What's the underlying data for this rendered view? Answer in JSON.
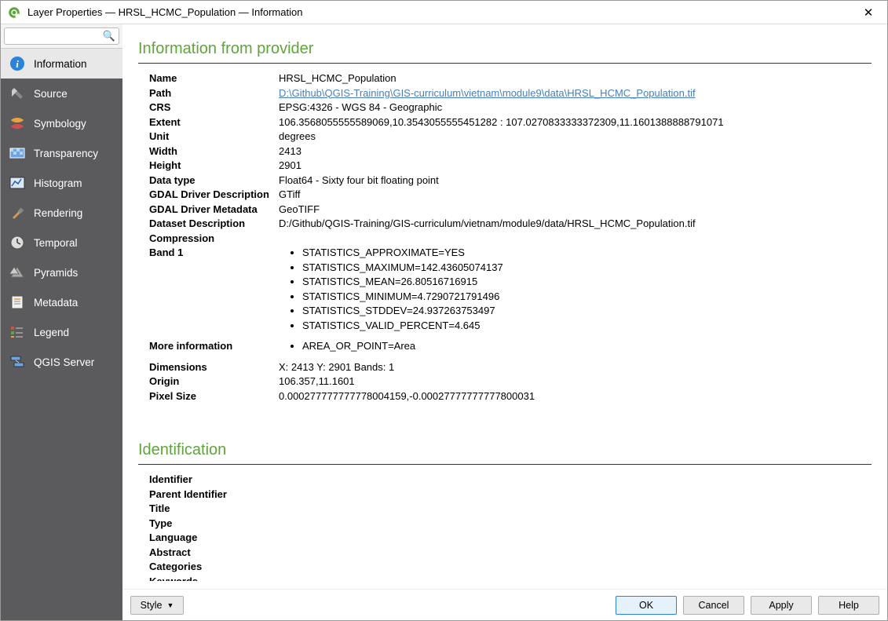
{
  "window": {
    "title": "Layer Properties — HRSL_HCMC_Population — Information"
  },
  "search": {
    "placeholder": ""
  },
  "sidebar": {
    "items": [
      {
        "label": "Information",
        "icon": "info-icon",
        "selected": true
      },
      {
        "label": "Source",
        "icon": "source-icon"
      },
      {
        "label": "Symbology",
        "icon": "symbology-icon"
      },
      {
        "label": "Transparency",
        "icon": "transparency-icon"
      },
      {
        "label": "Histogram",
        "icon": "histogram-icon"
      },
      {
        "label": "Rendering",
        "icon": "rendering-icon"
      },
      {
        "label": "Temporal",
        "icon": "temporal-icon"
      },
      {
        "label": "Pyramids",
        "icon": "pyramids-icon"
      },
      {
        "label": "Metadata",
        "icon": "metadata-icon"
      },
      {
        "label": "Legend",
        "icon": "legend-icon"
      },
      {
        "label": "QGIS Server",
        "icon": "server-icon"
      }
    ]
  },
  "sections": {
    "provider_title": "Information from provider",
    "identification_title": "Identification"
  },
  "provider": {
    "name_k": "Name",
    "name_v": "HRSL_HCMC_Population",
    "path_k": "Path",
    "path_v": "D:\\Github\\QGIS-Training\\GIS-curriculum\\vietnam\\module9\\data\\HRSL_HCMC_Population.tif",
    "crs_k": "CRS",
    "crs_v": "EPSG:4326 - WGS 84 - Geographic",
    "extent_k": "Extent",
    "extent_v": "106.3568055555589069,10.3543055555451282 : 107.0270833333372309,11.1601388888791071",
    "unit_k": "Unit",
    "unit_v": "degrees",
    "width_k": "Width",
    "width_v": "2413",
    "height_k": "Height",
    "height_v": "2901",
    "dtype_k": "Data type",
    "dtype_v": "Float64 - Sixty four bit floating point",
    "gdaldesc_k": "GDAL Driver Description",
    "gdaldesc_v": "GTiff",
    "gdalmeta_k": "GDAL Driver Metadata",
    "gdalmeta_v": "GeoTIFF",
    "dsdesc_k": "Dataset Description",
    "dsdesc_v": "D:/Github/QGIS-Training/GIS-curriculum/vietnam/module9/data/HRSL_HCMC_Population.tif",
    "compression_k": "Compression",
    "compression_v": "",
    "band1_k": "Band 1",
    "band1_items": [
      "STATISTICS_APPROXIMATE=YES",
      "STATISTICS_MAXIMUM=142.43605074137",
      "STATISTICS_MEAN=26.80516716915",
      "STATISTICS_MINIMUM=4.7290721791496",
      "STATISTICS_STDDEV=24.937263753497",
      "STATISTICS_VALID_PERCENT=4.645"
    ],
    "moreinfo_k": "More information",
    "moreinfo_items": [
      "AREA_OR_POINT=Area"
    ],
    "dimensions_k": "Dimensions",
    "dimensions_v": "X: 2413 Y: 2901 Bands: 1",
    "origin_k": "Origin",
    "origin_v": "106.357,11.1601",
    "pixelsize_k": "Pixel Size",
    "pixelsize_v": "0.000277777777778004159,-0.00027777777777800031"
  },
  "identification": {
    "identifier_k": "Identifier",
    "parentid_k": "Parent Identifier",
    "title_k": "Title",
    "type_k": "Type",
    "language_k": "Language",
    "abstract_k": "Abstract",
    "categories_k": "Categories",
    "keywords_k": "Keywords"
  },
  "buttons": {
    "style": "Style",
    "ok": "OK",
    "cancel": "Cancel",
    "apply": "Apply",
    "help": "Help"
  }
}
